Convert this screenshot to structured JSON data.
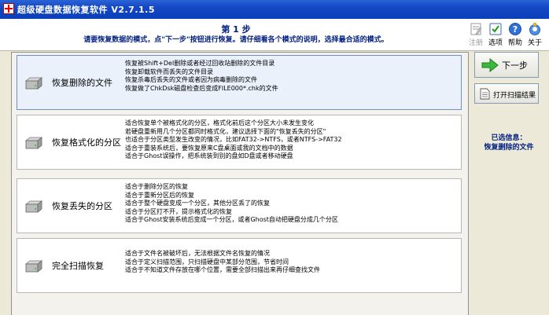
{
  "window": {
    "title": "超级硬盘数据恢复软件 V2.7.1.5"
  },
  "header": {
    "step_title": "第 1 步",
    "description": "请要恢复数据的模式，点\"下一步\"按钮进行恢复。请仔细看各个模式的说明，选择最合适的模式。"
  },
  "toolbar": {
    "register": "注册",
    "options": "选项",
    "help": "帮助",
    "about": "关于"
  },
  "options": [
    {
      "title": "恢复删除的文件",
      "selected": true,
      "lines": [
        "恢复被Shift+Del删除或者经过回收站删除的文件目录",
        "恢复卸载软件而丢失的文件目录",
        "恢复杀毒后丢失的文件或者因为病毒删除的文件",
        "恢复做了ChkDsk磁盘检查后变成FILE000*.chk的文件"
      ]
    },
    {
      "title": "恢复格式化的分区",
      "selected": false,
      "lines": [
        "适合恢复单个被格式化的分区，格式化前后这个分区大小未发生变化",
        "若硬盘重新用几个分区都同时格式化，建议选择下面的\"恢复丢失的分区\"",
        "也适合于分区类型发生改变的情况，比如FAT32->NTFS，或者NTFS->FAT32",
        "适合于重装系统后，要恢复原来C盘桌面或我的文档中的数据",
        "适合于Ghost误操作，把系统装到别的盘如D盘或者移动硬盘"
      ]
    },
    {
      "title": "恢复丢失的分区",
      "selected": false,
      "lines": [
        "适合于删除分区的恢复",
        "适合于重新分区后的恢复",
        "适合于整个硬盘变成一个分区，其他分区丢了的恢复",
        "适合于分区打不开，提示格式化的恢复",
        "适合于Ghost安装系统后变成一个分区，或者Ghost自动把硬盘分成几个分区"
      ]
    },
    {
      "title": "完全扫描恢复",
      "selected": false,
      "lines": [
        "适合于文件名被破坏后，无法根据文件名恢复的情况",
        "适合于定义扫描范围，只扫描硬盘中某部分范围，节省时间",
        "适合于不知道文件存放在哪个位置，需要全部扫描出来再仔细查找文件"
      ]
    }
  ],
  "buttons": {
    "next": "下一步",
    "open_scan": "打开扫描结果"
  },
  "selected_info": {
    "label": "已选信息：",
    "value": "恢复删除的文件"
  },
  "colors": {
    "titlebar": "#1447c4",
    "header_text": "#001f80",
    "selected_row": "#eaf1fb",
    "next_arrow": "#2fa52f"
  },
  "icons": {
    "register": "register-icon",
    "options": "options-icon",
    "help": "help-icon",
    "about": "about-icon",
    "drive": "hard-drive-icon",
    "next": "green-arrow-right-icon",
    "open_scan": "document-icon"
  }
}
